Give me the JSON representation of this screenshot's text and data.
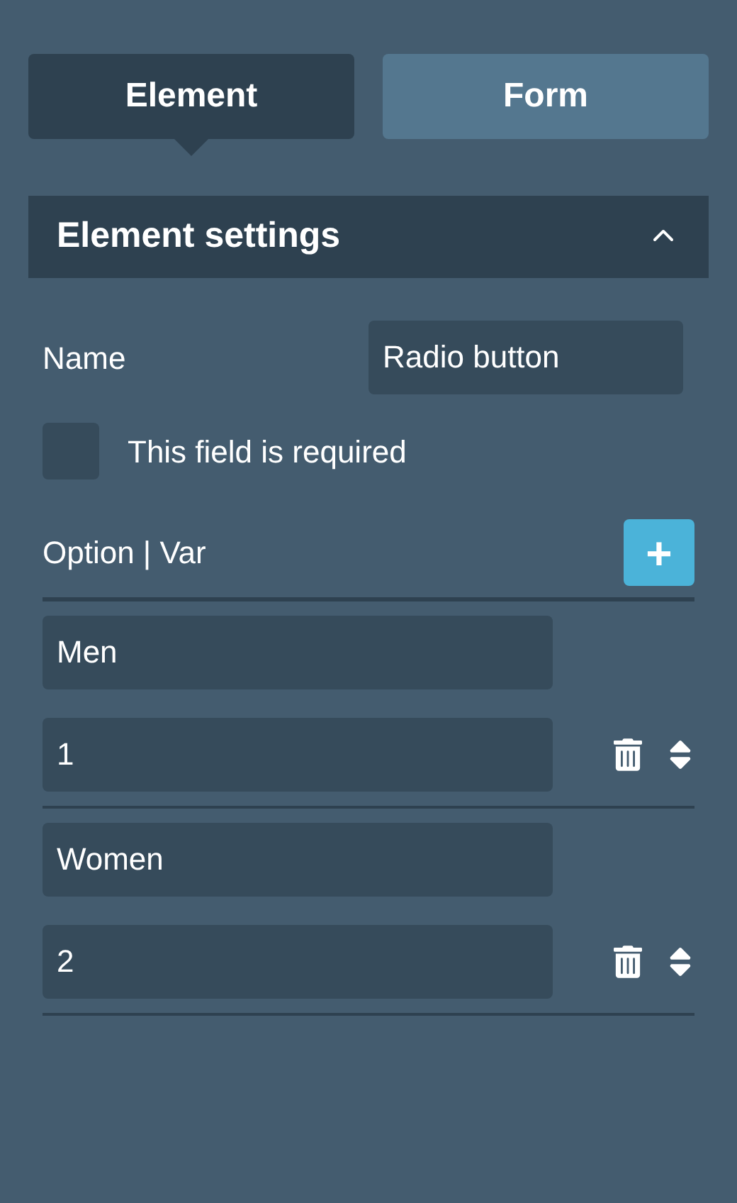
{
  "tabs": [
    {
      "label": "Element",
      "selected": true
    },
    {
      "label": "Form",
      "selected": false
    }
  ],
  "section": {
    "title": "Element settings",
    "expanded": true
  },
  "name_field": {
    "label": "Name",
    "value": "Radio button"
  },
  "required": {
    "label": "This field is required",
    "checked": false
  },
  "options_header": {
    "label": "Option | Var",
    "add_symbol": "+"
  },
  "options": [
    {
      "option": "Men",
      "var": "1"
    },
    {
      "option": "Women",
      "var": "2"
    }
  ]
}
